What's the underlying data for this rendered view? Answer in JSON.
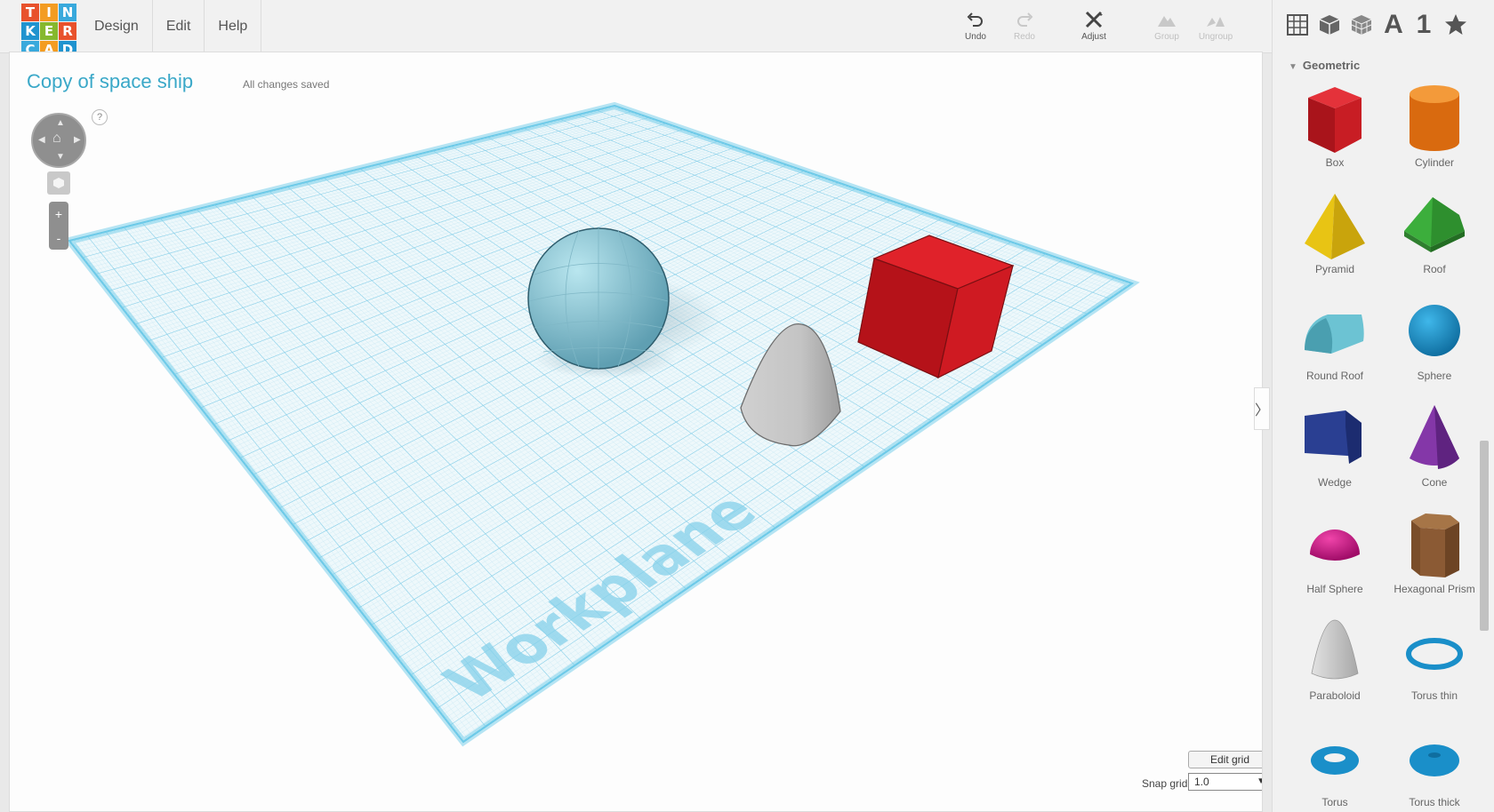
{
  "logo": {
    "letters": [
      "T",
      "I",
      "N",
      "K",
      "E",
      "R",
      "C",
      "A",
      "D"
    ],
    "colors": [
      "#e8522c",
      "#f39c22",
      "#39a9dc",
      "#1f93cf",
      "#86b82e",
      "#e8522c",
      "#39a9dc",
      "#f39c22",
      "#1f93cf"
    ]
  },
  "menu": [
    {
      "label": "Design"
    },
    {
      "label": "Edit"
    },
    {
      "label": "Help"
    }
  ],
  "toolbar": {
    "undo": "Undo",
    "redo": "Redo",
    "adjust": "Adjust",
    "group": "Group",
    "ungroup": "Ungroup"
  },
  "view_icons": {
    "text_label": "A",
    "number_label": "1"
  },
  "design": {
    "title": "Copy of space ship",
    "status": "All changes saved"
  },
  "workplane_label": "Workplane",
  "grid": {
    "edit_label": "Edit grid",
    "snap_label": "Snap grid",
    "snap_value": "1.0"
  },
  "controls": {
    "help": "?",
    "zoom_in": "+",
    "zoom_out": "-"
  },
  "panel": {
    "category": "Geometric",
    "shapes": [
      {
        "label": "Box",
        "icon": "box-icon",
        "color": "#d42027"
      },
      {
        "label": "Cylinder",
        "icon": "cylinder-icon",
        "color": "#e77817"
      },
      {
        "label": "Pyramid",
        "icon": "pyramid-icon",
        "color": "#e9c915"
      },
      {
        "label": "Roof",
        "icon": "roof-icon",
        "color": "#3aa63a"
      },
      {
        "label": "Round Roof",
        "icon": "round-roof-icon",
        "color": "#5db7c7"
      },
      {
        "label": "Sphere",
        "icon": "sphere-icon",
        "color": "#1a8fc9"
      },
      {
        "label": "Wedge",
        "icon": "wedge-icon",
        "color": "#233b8c"
      },
      {
        "label": "Cone",
        "icon": "cone-icon",
        "color": "#7a2d9c"
      },
      {
        "label": "Half Sphere",
        "icon": "half-sphere-icon",
        "color": "#d3138a"
      },
      {
        "label": "Hexagonal Prism",
        "icon": "hexagonal-prism-icon",
        "color": "#8b5a34"
      },
      {
        "label": "Paraboloid",
        "icon": "paraboloid-icon",
        "color": "#d8d8d8"
      },
      {
        "label": "Torus thin",
        "icon": "torus-thin-icon",
        "color": "#1a8fc9"
      },
      {
        "label": "Torus",
        "icon": "torus-icon",
        "color": "#1a8fc9"
      },
      {
        "label": "Torus thick",
        "icon": "torus-thick-icon",
        "color": "#1a8fc9"
      }
    ]
  }
}
